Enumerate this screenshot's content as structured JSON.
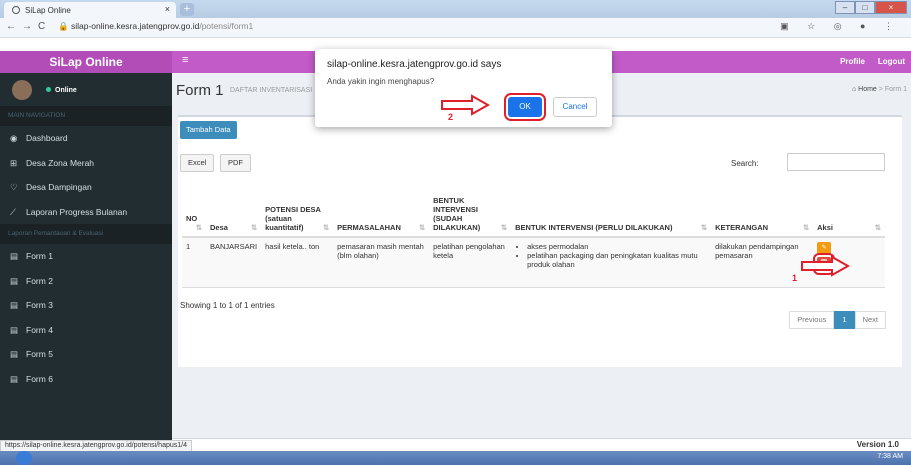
{
  "browser": {
    "tab_title": "SiLap Online",
    "tab_close": "×",
    "new_tab": "+",
    "url_host": "silap-online.kesra.jatengprov.go.id",
    "url_path": "/potensi/form1",
    "status_url": "https://silap-online.kesra.jatengprov.go.id/potensi/hapus1/4"
  },
  "header": {
    "brand": "SiLap Online",
    "menu": "≡",
    "profile": "Profile",
    "logout": "Logout"
  },
  "sidebar": {
    "status": "Online",
    "section_main": "MAIN NAVIGATION",
    "section_lap": "Laporan Pemantauan & Evaluasi",
    "items": [
      {
        "label": "Dashboard",
        "icon": "dashboard-icon"
      },
      {
        "label": "Desa Zona Merah",
        "icon": "plus-square-icon"
      },
      {
        "label": "Desa Dampingan",
        "icon": "heart-icon"
      },
      {
        "label": "Laporan Progress Bulanan",
        "icon": "line-chart-icon"
      }
    ],
    "forms": [
      "Form 1",
      "Form 2",
      "Form 3",
      "Form 4",
      "Form 5",
      "Form 6"
    ]
  },
  "page": {
    "title": "Form 1",
    "subtitle": "DAFTAR INVENTARISASI",
    "crumb_home": "Home",
    "crumb_sep": ">",
    "crumb_current": "Form 1"
  },
  "toolbar": {
    "tambah": "Tambah Data",
    "excel": "Excel",
    "pdf": "PDF",
    "search_label": "Search:"
  },
  "table": {
    "headers": [
      "NO",
      "Desa",
      "POTENSI DESA (satuan kuantitatif)",
      "PERMASALAHAN",
      "BENTUK INTERVENSI (SUDAH DILAKUKAN)",
      "BENTUK INTERVENSI (PERLU DILAKUKAN)",
      "KETERANGAN",
      "Aksi"
    ],
    "rows": [
      {
        "no": "1",
        "desa": "BANJARSARI",
        "potensi": "hasil ketela.. ton",
        "masalah": "pemasaran masih mentah (blm olahan)",
        "sudah": "pelatihan pengolahan ketela",
        "perlu": [
          "akses permodalan",
          "pelatihan packaging dan peningkatan kualitas mutu produk olahan"
        ],
        "keterangan": "dilakukan pendampingan pemasaran"
      }
    ],
    "info": "Showing 1 to 1 of 1 entries",
    "prev": "Previous",
    "page": "1",
    "next": "Next"
  },
  "footer": {
    "version": "Version 1.0"
  },
  "dialog": {
    "title": "silap-online.kesra.jatengprov.go.id says",
    "message": "Anda yakin ingin menghapus?",
    "ok": "OK",
    "cancel": "Cancel"
  },
  "annotations": {
    "step1": "1",
    "step2": "2"
  },
  "taskbar": {
    "clock": "7:38 AM"
  },
  "colors": {
    "header": "#c25bc8",
    "brand": "#b24db8",
    "sidebar": "#222d32",
    "primary": "#3c8dbc",
    "danger": "#dd4b39",
    "highlight": "#e01f2a"
  }
}
